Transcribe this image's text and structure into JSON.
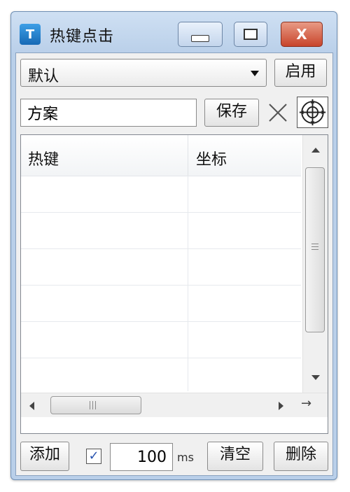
{
  "window": {
    "title": "热键点击",
    "icon_letter": "T"
  },
  "titlebar": {
    "close_label": "X"
  },
  "toolbar": {
    "scheme_select_value": "默认",
    "enable_label": "启用",
    "scheme_input_value": "方案",
    "save_label": "保存"
  },
  "table": {
    "columns": [
      "热键",
      "坐标"
    ],
    "rows": []
  },
  "footer": {
    "add_label": "添加",
    "checkbox_checked": true,
    "interval_value": "100",
    "interval_unit": "ms",
    "clear_label": "清空",
    "delete_label": "删除"
  },
  "icons": [
    "app-icon",
    "minimize-icon",
    "maximize-icon",
    "close-icon",
    "dropdown-arrow-icon",
    "clear-x-icon",
    "crosshair-target-icon",
    "scroll-up-icon",
    "scroll-down-icon",
    "scroll-left-icon",
    "scroll-right-icon",
    "checkbox-check-icon"
  ]
}
